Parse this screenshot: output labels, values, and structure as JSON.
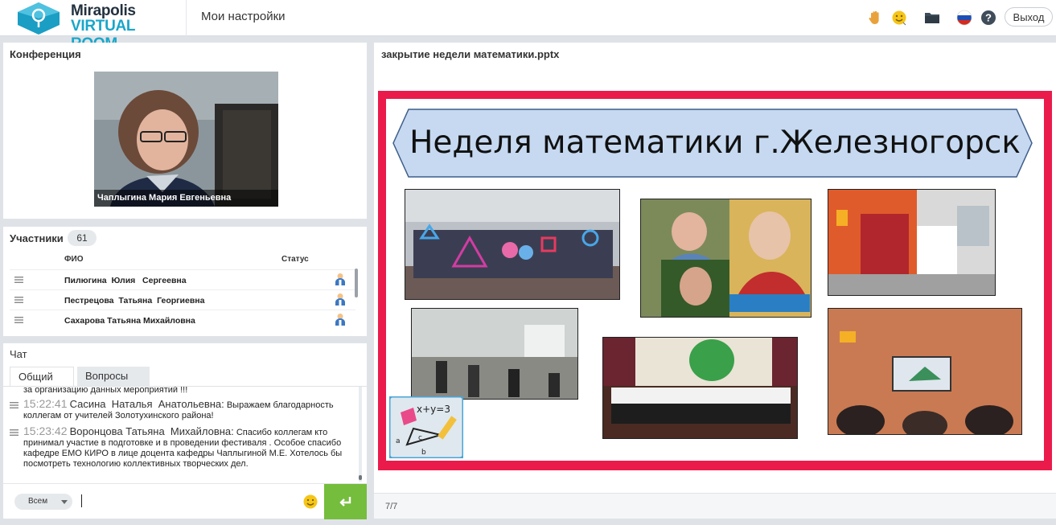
{
  "app": {
    "logo_line1": "Mirapolis",
    "logo_line2": "VIRTUAL ROOM",
    "my_settings": "Мои настройки",
    "exit": "Выход"
  },
  "conference": {
    "title": "Конференция",
    "video_caption": "Чаплыгина Мария Евгеньевна"
  },
  "participants": {
    "title": "Участники",
    "count": "61",
    "col_name": "ФИО",
    "col_status": "Статус",
    "rows": [
      {
        "name": "Пилюгина  Юлия   Сергеевна"
      },
      {
        "name": "Пестрецова  Татьяна  Георгиевна"
      },
      {
        "name": "Сахарова Татьяна Михайловна"
      }
    ]
  },
  "chat": {
    "title": "Чат",
    "tab_general": "Общий",
    "tab_questions": "Вопросы",
    "partial_line": "за организацию данных мероприятий !!!",
    "messages": [
      {
        "time": "15:22:41",
        "author": "Сасина  Наталья  Анатольевна:",
        "text": "Выражаем благодарность коллегам от учителей Золотухинского района!"
      },
      {
        "time": "15:23:42",
        "author": "Воронцова Татьяна  Михайловна:",
        "text": "Спасибо коллегам кто принимал участие в подготовке и в проведении фестиваля . Особое спасибо кафедре ЕМО КИРО в лице доцента кафедры Чаплыгиной М.Е. Хотелось бы посмотреть технологию коллективных творческих дел."
      }
    ],
    "recipient": "Всем"
  },
  "presentation": {
    "file_name": "закрытие недели математики.pptx",
    "slide_title": "Неделя математики г.Железногорск",
    "formula": "x+y=3",
    "pager": "7/7"
  },
  "colors": {
    "slide_border": "#ea1b4b",
    "banner_fill": "#c6d9f1",
    "send_button": "#75bd3c",
    "logo_accent": "#1aa6c9"
  }
}
